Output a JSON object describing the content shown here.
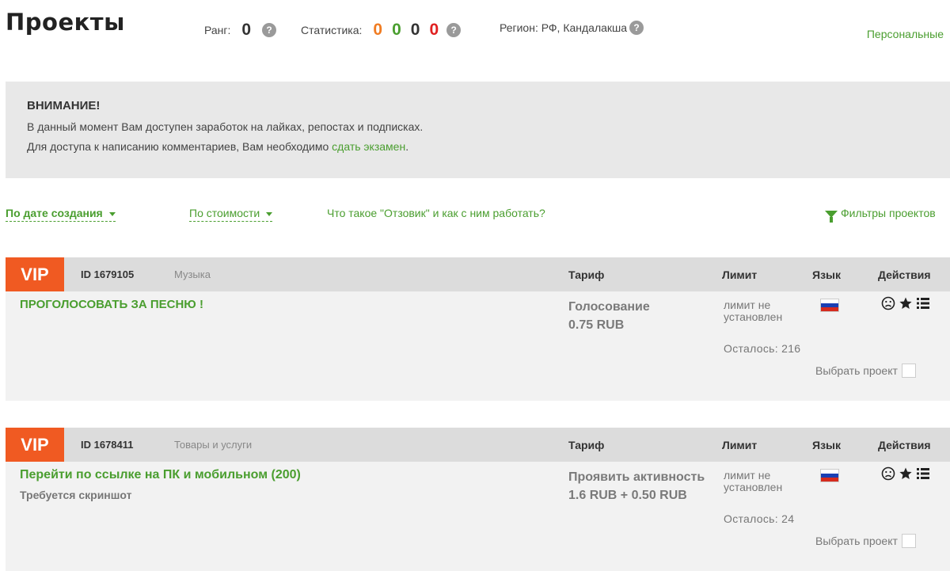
{
  "header": {
    "title": "Проекты",
    "rank_label": "Ранг:",
    "rank_value": "0",
    "stats_label": "Статистика:",
    "stats": [
      {
        "value": "0",
        "color": "#f07c22"
      },
      {
        "value": "0",
        "color": "#4a9e2f"
      },
      {
        "value": "0",
        "color": "#333333"
      },
      {
        "value": "0",
        "color": "#e02020"
      }
    ],
    "region_label": "Регион: РФ, Кандалакша",
    "help_glyph": "?",
    "personal_link": "Персональные"
  },
  "notice": {
    "title": "ВНИМАНИЕ!",
    "line1": "В данный момент Вам доступен заработок на лайках, репостах и подписках.",
    "line2_text": "Для доступа к написанию комментариев, Вам необходимо",
    "line2_link": "сдать экзамен",
    "line2_end": "."
  },
  "sortbar": {
    "by_date": "По дате создания",
    "by_price": "По стоимости",
    "about": "Что такое \"Отзовик\" и как с ним работать?",
    "filters": "Фильтры проектов"
  },
  "columns": {
    "tariff": "Тариф",
    "limit": "Лимит",
    "language": "Язык",
    "actions": "Действия"
  },
  "projects": [
    {
      "badge": "VIP",
      "id": "ID 1679105",
      "category": "Музыка",
      "title": "ПРОГОЛОСОВАТЬ ЗА ПЕСНЮ !",
      "subtitle": "",
      "tariff_name": "Голосование",
      "tariff_price": "0.75 RUB",
      "limit_line1": "лимит не",
      "limit_line2": "установлен",
      "remaining": "Осталось: 216",
      "select_label": "Выбрать проект",
      "flag": "russia-flag"
    },
    {
      "badge": "VIP",
      "id": "ID 1678411",
      "category": "Товары и услуги",
      "title": "Перейти по ссылке на ПК и мобильном (200)",
      "subtitle": "Требуется скриншот",
      "tariff_name": "Проявить активность",
      "tariff_price": "1.6 RUB + 0.50 RUB",
      "limit_line1": "лимит не",
      "limit_line2": "установлен",
      "remaining": "Осталось: 24",
      "select_label": "Выбрать проект",
      "flag": "russia-flag"
    }
  ],
  "icons": {
    "help": "question-icon",
    "filter": "filter-icon",
    "sad": "sad-face-icon",
    "star": "star-icon",
    "list": "list-icon"
  }
}
